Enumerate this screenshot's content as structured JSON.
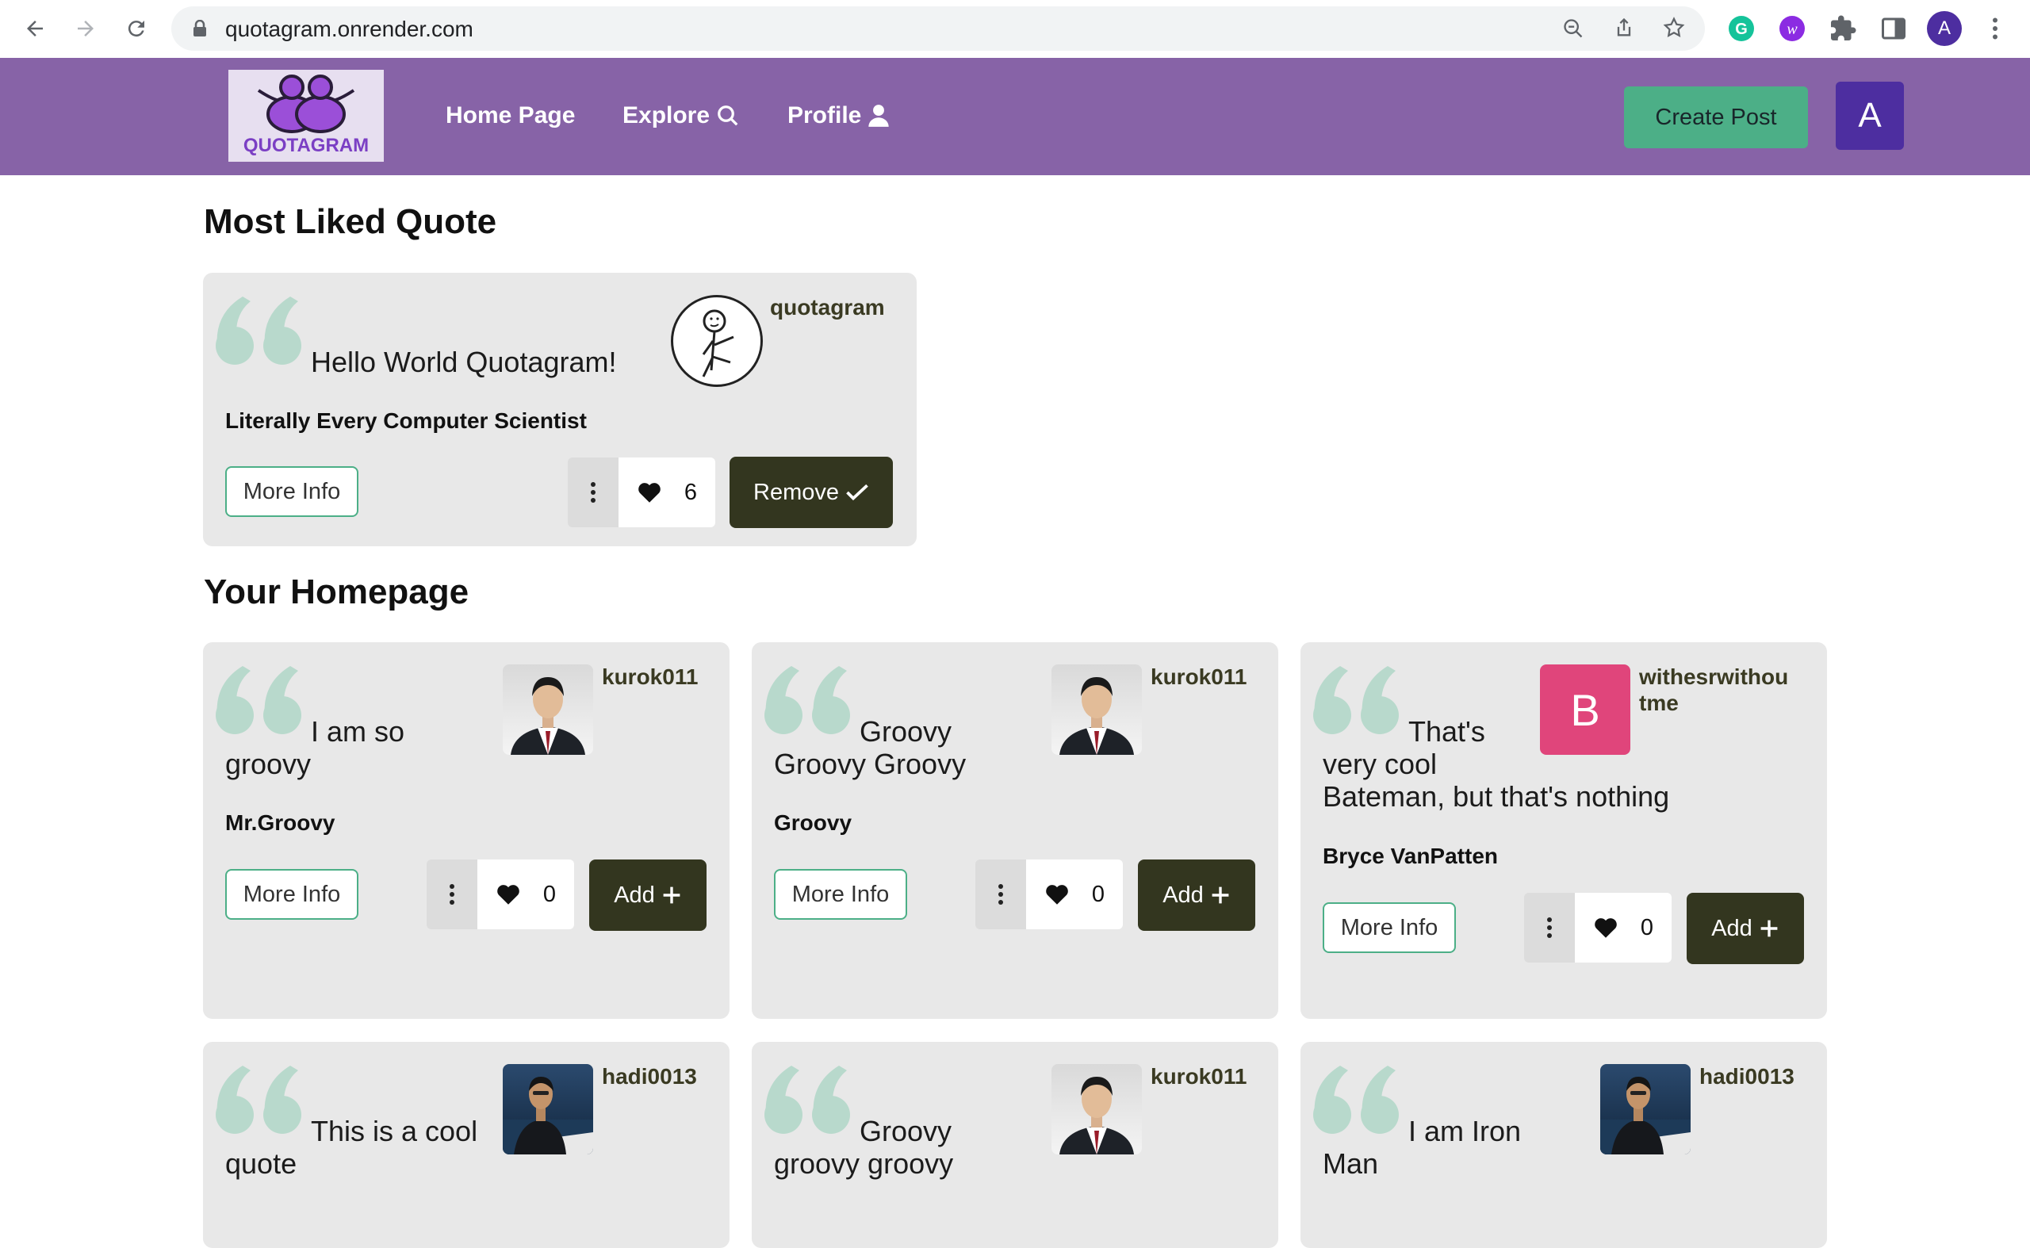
{
  "browser": {
    "url": "quotagram.onrender.com",
    "profile_initial": "A"
  },
  "app": {
    "logo_text": "QUOTAGRAM",
    "nav": {
      "home": "Home Page",
      "explore": "Explore",
      "profile": "Profile"
    },
    "create_post": "Create Post",
    "user_initial": "A"
  },
  "most_liked": {
    "heading": "Most Liked Quote",
    "quote": "Hello World Quotagram!",
    "author": "Literally Every Computer Scientist",
    "username": "quotagram",
    "likes": "6",
    "more_info": "More Info",
    "action": "Remove"
  },
  "homepage": {
    "heading": "Your Homepage",
    "cards": [
      {
        "quote_first": "I am so",
        "quote_rest": "groovy",
        "author": "Mr.Groovy",
        "username": "kurok011",
        "likes": "0",
        "more_info": "More Info",
        "action": "Add"
      },
      {
        "quote_first": "Groovy",
        "quote_rest": "Groovy Groovy",
        "author": "Groovy",
        "username": "kurok011",
        "likes": "0",
        "more_info": "More Info",
        "action": "Add"
      },
      {
        "quote_first": "That's",
        "quote_rest": "very cool",
        "quote_rest2": "Bateman, but that's nothing",
        "author": "Bryce VanPatten",
        "username_l1": "withesrwithou",
        "username_l2": "tme",
        "avatar_letter": "B",
        "likes": "0",
        "more_info": "More Info",
        "action": "Add"
      },
      {
        "quote_first": "This is a cool",
        "quote_rest": "quote",
        "username": "hadi0013"
      },
      {
        "quote_first": "Groovy",
        "quote_rest": "groovy groovy",
        "username": "kurok011"
      },
      {
        "quote_first": "I am Iron",
        "quote_rest": "Man",
        "username": "hadi0013"
      }
    ]
  },
  "colors": {
    "header_bg": "#8763a7",
    "create_post_bg": "#4caf87",
    "action_bg": "#33361f",
    "quote_mark": "#b8d9cc",
    "letter_avatar_bg": "#e0457b"
  }
}
